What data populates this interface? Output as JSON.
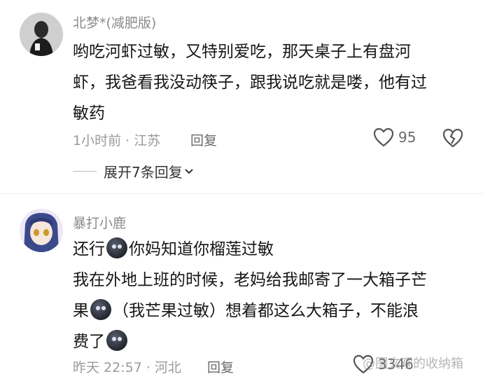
{
  "comments": [
    {
      "username": "北梦*(减肥版)",
      "lines": [
        "哟吃河虾过敏，又特别爱吃，那天桌子上有盘河",
        "虾，我爸看我没动筷子，跟我说吃就是喽，他有过",
        "敏药"
      ],
      "meta": "1小时前 · 江苏",
      "reply_label": "回复",
      "likes": "95",
      "expand_label": "展开7条回复"
    },
    {
      "username": "暴打小鹿",
      "line1_a": "还行",
      "line1_b": "你妈知道你榴莲过敏",
      "line2": "我在外地上班的时候，老妈给我邮寄了一大箱子芒",
      "line3_a": "果",
      "line3_b": "（我芒果过敏）想着都这么大箱子，不能浪",
      "line4": "费了",
      "meta": "昨天 22:57 · 河北",
      "reply_label": "回复",
      "likes": "3346"
    }
  ],
  "watermark": "@图文观的收纳箱",
  "icons": {
    "like": "heart-outline-icon",
    "dislike": "broken-heart-icon",
    "emoji": "dark-face-emoji",
    "expand": "chevron-down-icon"
  },
  "colors": {
    "text": "#161616",
    "muted": "#9a9a9a"
  }
}
